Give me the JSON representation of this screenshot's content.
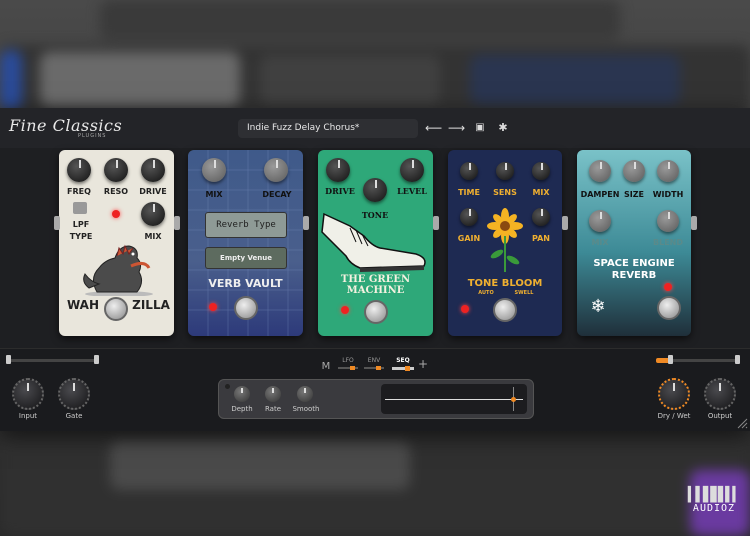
{
  "header": {
    "logo": "Fine Classics",
    "logo_sub": "PLUGINS",
    "preset_name": "Indie Fuzz Delay Chorus*",
    "icons": [
      "arrow-left-icon",
      "arrow-right-icon",
      "save-icon",
      "gear-icon"
    ],
    "back_glyph": "⟵",
    "forward_glyph": "⟶",
    "save_glyph": "▣",
    "settings_glyph": "✱"
  },
  "pedals": {
    "wahzilla": {
      "knob1": "FREQ",
      "knob2": "RESO",
      "knob3": "DRIVE",
      "switch_label1": "LPF",
      "switch_label2": "TYPE",
      "knob4": "MIX",
      "name_left": "WAH",
      "name_right": "ZILLA",
      "color": "#e9e6dc"
    },
    "verbvault": {
      "knob1": "MIX",
      "knob2": "DECAY",
      "type_label": "Reverb Type",
      "type_value": "Empty Venue",
      "name": "VERB VAULT",
      "color": "#4a5f8c"
    },
    "greenmachine": {
      "knob1": "DRIVE",
      "knob2": "LEVEL",
      "knob3": "TONE",
      "name": "THE GREEN MACHINE",
      "color": "#2ea879"
    },
    "tonebloom": {
      "knob1": "TIME",
      "knob2": "SENS",
      "knob3": "MIX",
      "knob4": "GAIN",
      "knob5": "PAN",
      "name": "TONE BLOOM",
      "sub_left": "AUTO",
      "sub_right": "SWELL",
      "color": "#1e2a52"
    },
    "spaceengine": {
      "knob1": "DAMPEN",
      "knob2": "SIZE",
      "knob3": "WIDTH",
      "knob4": "MIX",
      "knob5": "BLEND",
      "name": "SPACE ENGINE REVERB",
      "color": "#3d8a96"
    }
  },
  "bottom": {
    "input_label": "Input",
    "gate_label": "Gate",
    "mod_tab_m": "M",
    "mod_tabs": [
      "LFO",
      "ENV",
      "SEQ"
    ],
    "active_mod_tab": "SEQ",
    "add_glyph": "+",
    "mod_knobs": [
      "Depth",
      "Rate",
      "Smooth"
    ],
    "drywet_label": "Dry / Wet",
    "output_label": "Output",
    "accent": "#f08a24"
  },
  "watermark": "AUDIOZ"
}
